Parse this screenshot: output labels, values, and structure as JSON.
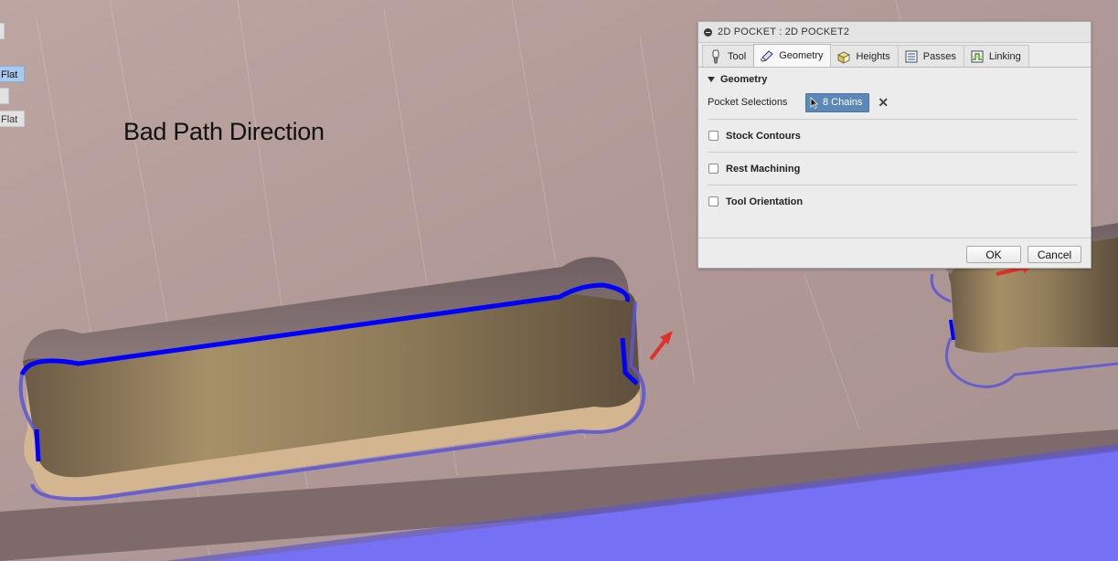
{
  "left_panel": {
    "items": [
      {
        "label": "",
        "active": false
      },
      {
        "label": "Flat",
        "active": true
      },
      {
        "label": "",
        "active": false
      },
      {
        "label": "Flat",
        "active": false
      }
    ]
  },
  "annotation": "Bad Path Direction",
  "dialog": {
    "title": "2D POCKET : 2D POCKET2",
    "tabs": [
      {
        "label": "Tool",
        "icon": "tool-icon",
        "active": false
      },
      {
        "label": "Geometry",
        "icon": "geometry-icon",
        "active": true
      },
      {
        "label": "Heights",
        "icon": "heights-icon",
        "active": false
      },
      {
        "label": "Passes",
        "icon": "passes-icon",
        "active": false
      },
      {
        "label": "Linking",
        "icon": "linking-icon",
        "active": false
      }
    ],
    "section_title": "Geometry",
    "pocket_selections_label": "Pocket Selections",
    "chains_label": "8 Chains",
    "clear_label": "✕",
    "options": [
      {
        "label": "Stock Contours",
        "checked": false
      },
      {
        "label": "Rest Machining",
        "checked": false
      },
      {
        "label": "Tool Orientation",
        "checked": false
      }
    ],
    "ok_label": "OK",
    "cancel_label": "Cancel"
  },
  "colors": {
    "selected_chain": "#5b88b8",
    "toolpath_contour": "#0000ff",
    "toolpath_offset": "#5b55d8",
    "direction_arrow": "#e0302a",
    "work_plane": "#7670f5"
  }
}
